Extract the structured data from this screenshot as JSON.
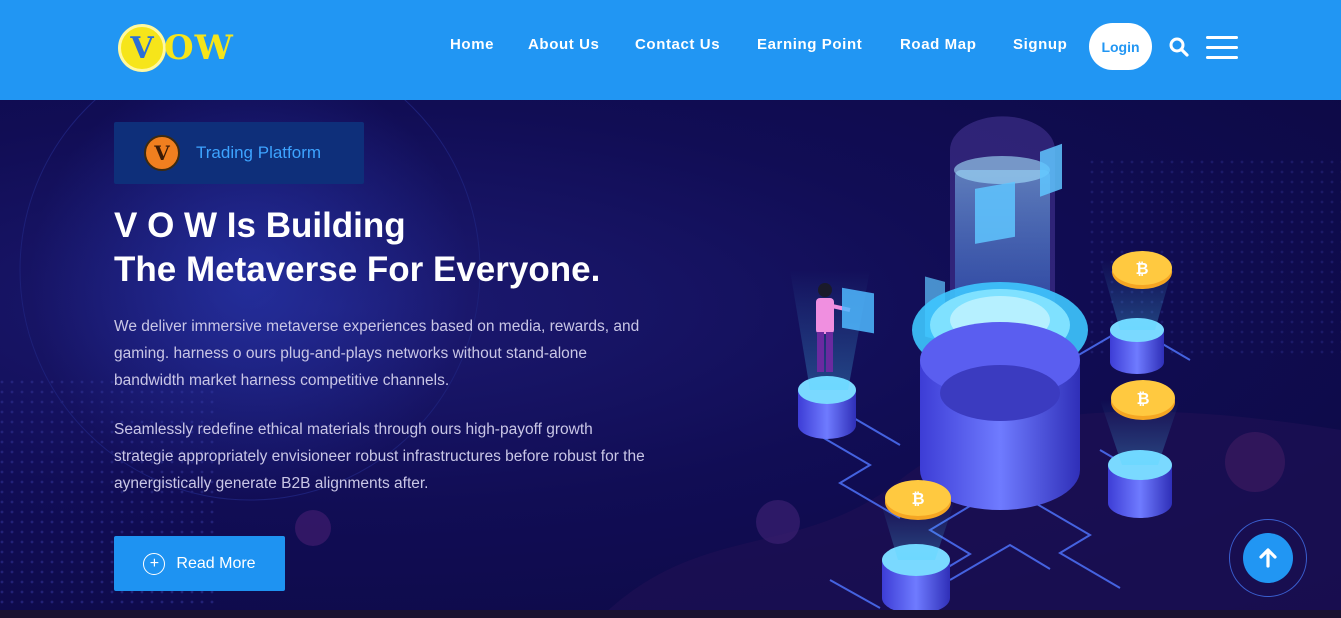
{
  "brand": {
    "logo_letter": "V",
    "logo_text": "OW"
  },
  "nav": {
    "items": [
      {
        "label": "Home"
      },
      {
        "label": "About Us"
      },
      {
        "label": "Contact Us"
      },
      {
        "label": "Earning Point"
      },
      {
        "label": "Road Map"
      },
      {
        "label": "Signup"
      }
    ],
    "login_label": "Login"
  },
  "hero": {
    "tag_label": "Trading Platform",
    "tag_icon_letter": "V",
    "headline_line1": "V O W Is Building",
    "headline_line2": "The Metaverse For Everyone.",
    "paragraph1": "We deliver immersive metaverse experiences based on media, rewards, and gaming. harness o ours plug-and-plays networks without stand-alone bandwidth market harness competitive channels.",
    "paragraph2": "Seamlessly redefine ethical materials through ours high-payoff growth strategie appropriately envisioneer robust infrastructures before robust for the aynergistically generate B2B alignments after.",
    "cta_label": "Read More"
  },
  "icons": {
    "search": "search-icon",
    "menu": "menu-icon",
    "plus": "plus-circle-icon",
    "scroll_top": "arrow-up-icon"
  },
  "colors": {
    "header_bg": "#2196f3",
    "hero_bg": "#110d55",
    "accent": "#1e93f2",
    "logo_yellow": "#f6e51a"
  }
}
